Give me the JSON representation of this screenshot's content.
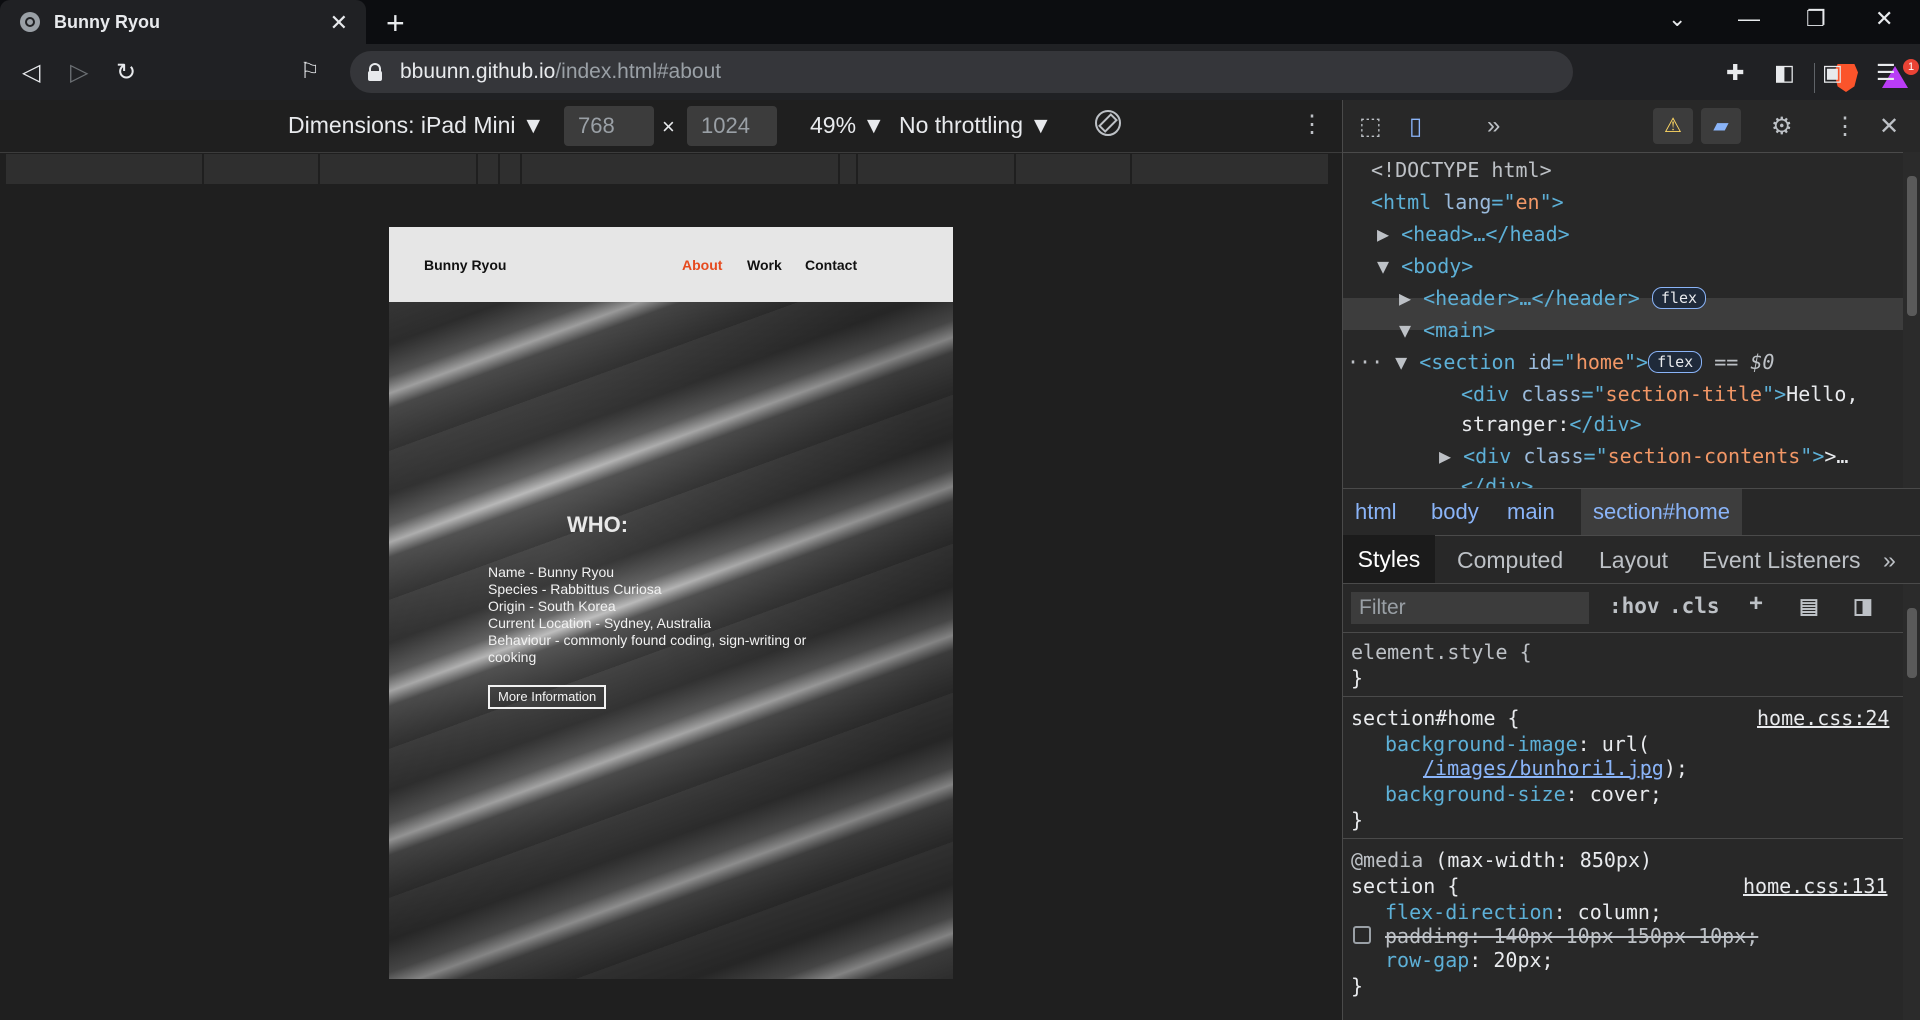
{
  "browser": {
    "tab_title": "Bunny Ryou",
    "url_host": "bbuunn.github.io",
    "url_path": "/index.html#about",
    "rewards_badge": "1"
  },
  "device_toolbar": {
    "dimensions_label": "Dimensions: iPad Mini ▼",
    "width_value": "768",
    "height_value": "1024",
    "times": "×",
    "zoom": "49% ▼",
    "throttling": "No throttling ▼"
  },
  "site": {
    "brand": "Bunny Ryou",
    "nav": [
      "About",
      "Work",
      "Contact"
    ],
    "active_nav": "About",
    "heading": "WHO:",
    "bio_lines": [
      "Name - Bunny Ryou",
      "Species - Rabbittus Curiosa",
      "Origin - South Korea",
      "Current Location - Sydney, Australia",
      "Behaviour - commonly found coding, sign-writing or cooking"
    ],
    "more_button": "More Information"
  },
  "devtools": {
    "dom": {
      "doctype": "<!DOCTYPE html>",
      "html_open": "<html ",
      "html_attr": "lang",
      "html_eq": "=\"",
      "html_val": "en",
      "html_close": "\">",
      "head": "<head>…</head>",
      "body": "<body>",
      "header": "<header>…</header>",
      "main": "<main>",
      "section_open": "<section ",
      "section_attr": "id",
      "section_val": "home",
      "section_close": "\">",
      "flex": "flex",
      "selected_marker": "== $0",
      "div1_open": "<div ",
      "div1_attr": "class",
      "div1_val": "section-title",
      "div1_text": "Hello,",
      "div1_text2": "stranger:",
      "div1_end": "</div>",
      "div2_val": "section-contents",
      "div2_end": ">…",
      "div2_close": "</div>"
    },
    "breadcrumbs": [
      "html",
      "body",
      "main",
      "section#home"
    ],
    "subtabs": [
      "Styles",
      "Computed",
      "Layout",
      "Event Listeners"
    ],
    "filter_placeholder": "Filter",
    "hov": ":hov",
    "cls": ".cls",
    "styles": {
      "element_style": "element.style {",
      "close_brace": "}",
      "rule1_selector": "section#home {",
      "rule1_source": "home.css:24",
      "rule1_prop1": "background-image",
      "rule1_val1_pre": ": url(",
      "rule1_val1_url": "/images/bunhori1.jpg",
      "rule1_val1_post": ");",
      "rule1_prop2": "background-size",
      "rule1_val2": ": cover;",
      "media": "@media",
      "media_query": " (max-width: 850px)",
      "rule2_selector": "section {",
      "rule2_source": "home.css:131",
      "rule2_prop1": "flex-direction",
      "rule2_val1": ": column;",
      "rule2_prop2": "padding: 140px 10px 150px 10px;",
      "rule2_prop3": "row-gap",
      "rule2_val3": ": 20px;"
    }
  },
  "colors": {
    "accent_nav": "#e64a1e",
    "devtools_blue": "#8ab4f8"
  }
}
